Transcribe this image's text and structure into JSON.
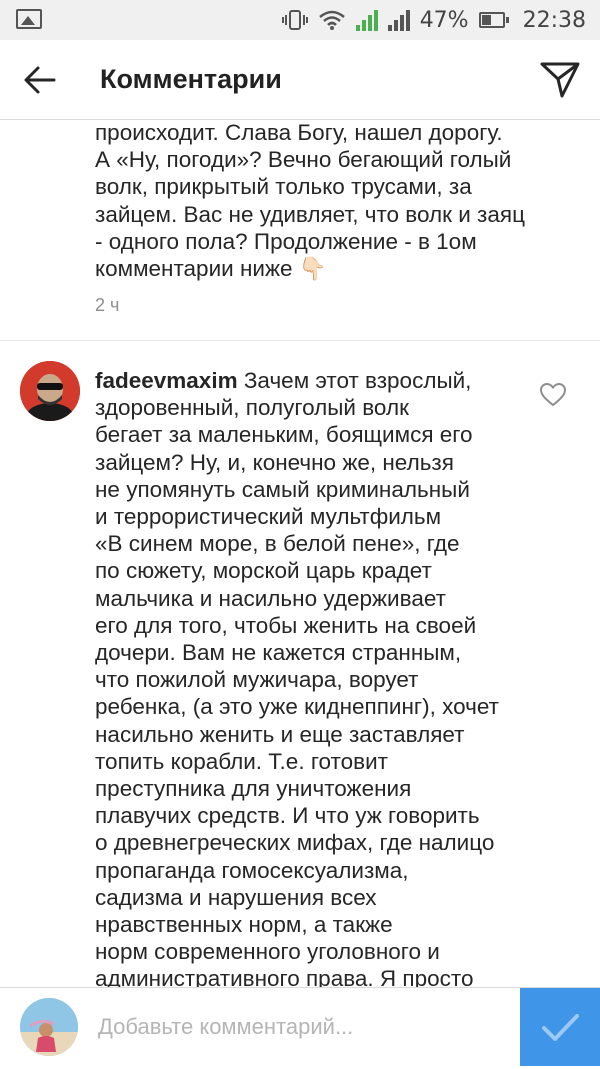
{
  "status_bar": {
    "battery_percent": "47%",
    "time": "22:38"
  },
  "header": {
    "title": "Комментарии"
  },
  "comments": [
    {
      "username": "",
      "text": "происходит. Слава Богу, нашел дорогу.\nА «Ну, погоди»? Вечно бегающий голый\nволк, прикрытый только трусами, за\nзайцем. Вас не удивляет, что волк и заяц\n- одного пола? Продолжение - в 1ом\nкомментарии ниже 👇🏻",
      "time": "2 ч"
    },
    {
      "username": "fadeevmaxim",
      "text": " Зачем этот взрослый,\nздоровенный, полуголый волк\nбегает за маленьким, боящимся его\nзайцем? Ну, и, конечно же, нельзя\nне упомянуть самый криминальный\nи террористический мультфильм\n«В синем море, в белой пене», где\nпо сюжету, морской царь крадет\nмальчика и насильно удерживает\nего для того, чтобы женить на своей\nдочери. Вам не кажется странным,\nчто пожилой мужичара, ворует\nребенка, (а это уже киднеппинг), хочет\nнасильно женить и еще заставляет\nтопить корабли. Т.е. готовит\nпреступника  для уничтожения\nплавучих средств.  И что уж говорить\nо древнегреческих мифах, где налицо\nпропаганда гомосексуализма,\nсадизма и нарушения всех\nнравственных норм, а также\nнорм современного уголовного и\nадминистративного права. Я просто"
    }
  ],
  "composer": {
    "placeholder": "Добавьте комментарий..."
  },
  "colors": {
    "accent": "#3f95e8",
    "muted": "#8e8e8e"
  },
  "icons": [
    "back-arrow-icon",
    "send-icon",
    "heart-icon",
    "checkmark-icon"
  ]
}
